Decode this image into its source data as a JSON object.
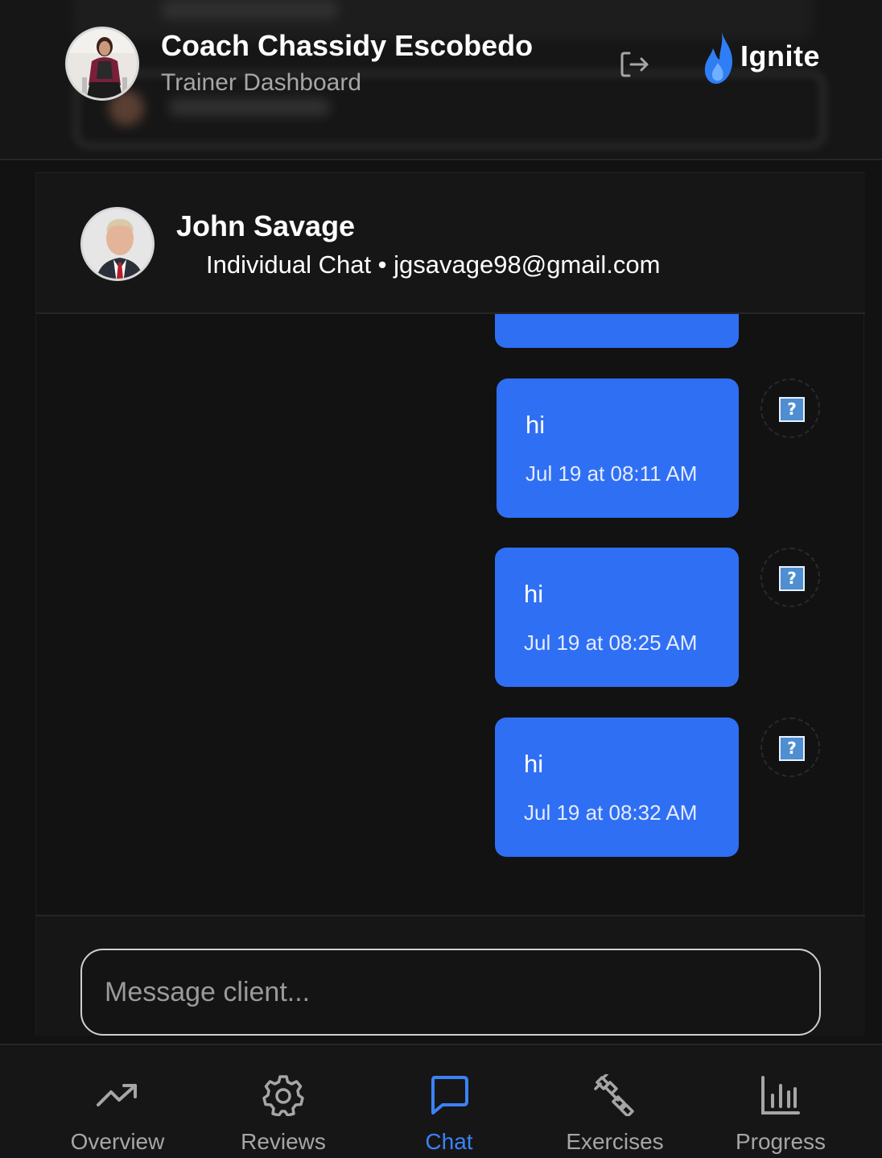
{
  "header": {
    "coach_name": "Coach Chassidy Escobedo",
    "subtitle": "Trainer Dashboard",
    "brand_name": "Ignite",
    "logout_icon": "logout-icon"
  },
  "chat": {
    "client_name": "John Savage",
    "client_meta": "Individual Chat • jgsavage98@gmail.com",
    "messages": [
      {
        "text": "hi",
        "time": "Jul 19 at 08:11 AM",
        "status_icon": "question-mark-icon"
      },
      {
        "text": "hi",
        "time": "Jul 19 at 08:25 AM",
        "status_icon": "question-mark-icon"
      },
      {
        "text": "hi",
        "time": "Jul 19 at 08:32 AM",
        "status_icon": "question-mark-icon"
      }
    ],
    "composer": {
      "placeholder": "Message client...",
      "value": ""
    }
  },
  "nav": {
    "items": [
      {
        "label": "Overview",
        "icon": "trending-up-icon"
      },
      {
        "label": "Reviews",
        "icon": "gear-icon"
      },
      {
        "label": "Chat",
        "icon": "chat-bubble-icon",
        "active": true
      },
      {
        "label": "Exercises",
        "icon": "dumbbell-icon"
      },
      {
        "label": "Progress",
        "icon": "bar-chart-icon"
      }
    ]
  },
  "colors": {
    "background": "#121212",
    "bubble": "#2f6ff4",
    "accent": "#3b82f6",
    "muted": "#a6a6a6"
  }
}
